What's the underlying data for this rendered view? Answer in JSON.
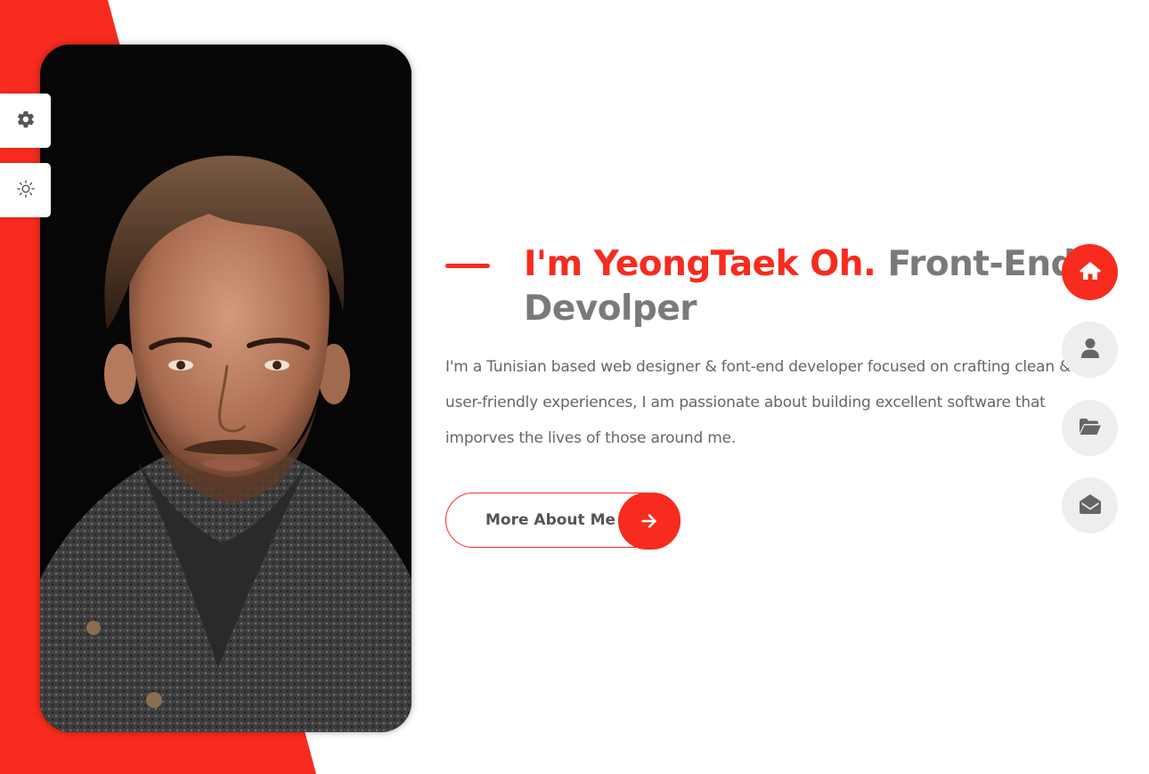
{
  "colors": {
    "accent": "#f72b1e",
    "title_gray": "#7a7a7a",
    "text_gray": "#666666",
    "nav_bg": "#eeeeee"
  },
  "side_tools": [
    {
      "icon": "gear-icon"
    },
    {
      "icon": "sun-icon"
    }
  ],
  "hero": {
    "name": "I'm YeongTaek Oh.",
    "role": "Front-End Devolper",
    "description": "I'm a Tunisian based web designer & font-end developer focused on crafting clean & user-friendly experiences, I am passionate about building excellent software that imporves the lives of those around me.",
    "button_label": "More About Me",
    "button_icon": "arrow-right-icon"
  },
  "nav": [
    {
      "icon": "home-icon",
      "active": true
    },
    {
      "icon": "user-icon",
      "active": false
    },
    {
      "icon": "folder-open-icon",
      "active": false
    },
    {
      "icon": "envelope-open-icon",
      "active": false
    }
  ]
}
